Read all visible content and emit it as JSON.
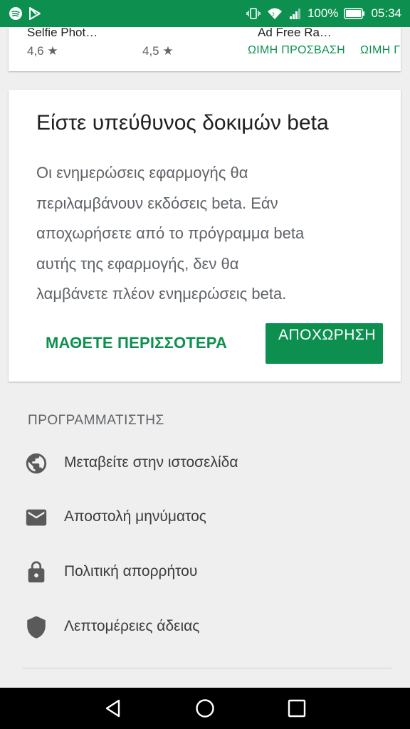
{
  "status_bar": {
    "battery": "100%",
    "time": "05:34"
  },
  "apps_row": {
    "apps": [
      {
        "name": "Selfie Phot…",
        "rating": "4,6 ★"
      },
      {
        "name": "",
        "rating": "4,5 ★"
      },
      {
        "name": "Ad Free Ra…",
        "access": "ΩΙΜΗ ΠΡΟΣΒΑΣΗ"
      },
      {
        "name": "",
        "access": "ΩΙΜΗ Γ"
      }
    ]
  },
  "beta_card": {
    "title": "Είστε υπεύθυνος δοκιμών beta",
    "body_lines": [
      "Οι ενημερώσεις εφαρμογής θα",
      "περιλαμβάνουν εκδόσεις beta. Εάν",
      "αποχωρήσετε από το πρόγραμμα beta",
      "αυτής της εφαρμογής, δεν θα",
      "λαμβάνετε πλέον ενημερώσεις beta."
    ],
    "learn_more_label": "ΜΑΘΕΤΕ ΠΕΡΙΣΣΟΤΕΡΑ",
    "leave_label": "ΑΠΟΧΩΡΗΣΗ"
  },
  "developer": {
    "header": "ΠΡΟΓΡΑΜΜΑΤΙΣΤΗΣ",
    "items": [
      {
        "icon": "globe-icon",
        "label": "Μεταβείτε στην ιστοσελίδα"
      },
      {
        "icon": "email-icon",
        "label": "Αποστολή μηνύματος"
      },
      {
        "icon": "lock-icon",
        "label": "Πολιτική απορρήτου"
      },
      {
        "icon": "shield-icon",
        "label": "Λεπτομέρειες άδειας"
      }
    ]
  },
  "colors": {
    "accent": "#0d904f",
    "background": "#efefef"
  }
}
